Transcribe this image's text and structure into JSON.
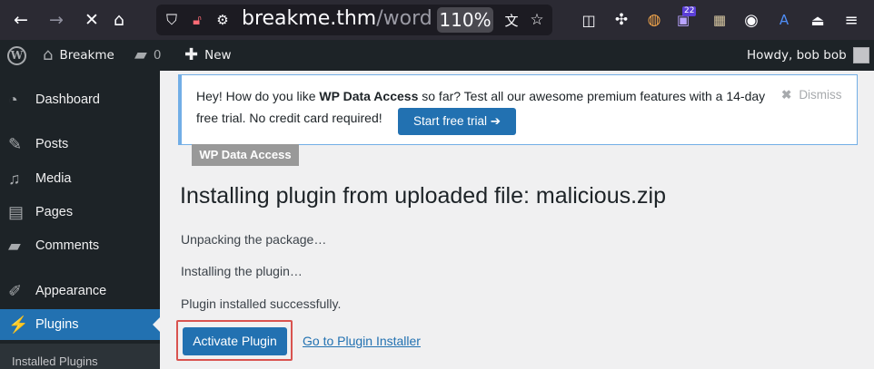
{
  "browser": {
    "url_host": "breakme.thm",
    "url_path": "/word",
    "zoom": "110%",
    "extension_badge": "22"
  },
  "adminbar": {
    "site_name": "Breakme",
    "comments_count": "0",
    "new_label": "New",
    "howdy": "Howdy, bob bob"
  },
  "sidebar": {
    "items": [
      {
        "label": "Dashboard"
      },
      {
        "label": "Posts"
      },
      {
        "label": "Media"
      },
      {
        "label": "Pages"
      },
      {
        "label": "Comments"
      },
      {
        "label": "Appearance"
      },
      {
        "label": "Plugins"
      }
    ],
    "submenu_first": "Installed Plugins"
  },
  "notice": {
    "text_before": "Hey! How do you like ",
    "text_bold": "WP Data Access",
    "text_after": " so far? Test all our awesome premium features with a 14-day free trial. No credit card required!",
    "trial_button": "Start free trial ➔",
    "dismiss": "Dismiss"
  },
  "plugin_tag": "WP Data Access",
  "main": {
    "title": "Installing plugin from uploaded file: malicious.zip",
    "steps": [
      "Unpacking the package…",
      "Installing the plugin…",
      "Plugin installed successfully."
    ],
    "activate_button": "Activate Plugin",
    "installer_link": "Go to Plugin Installer"
  }
}
